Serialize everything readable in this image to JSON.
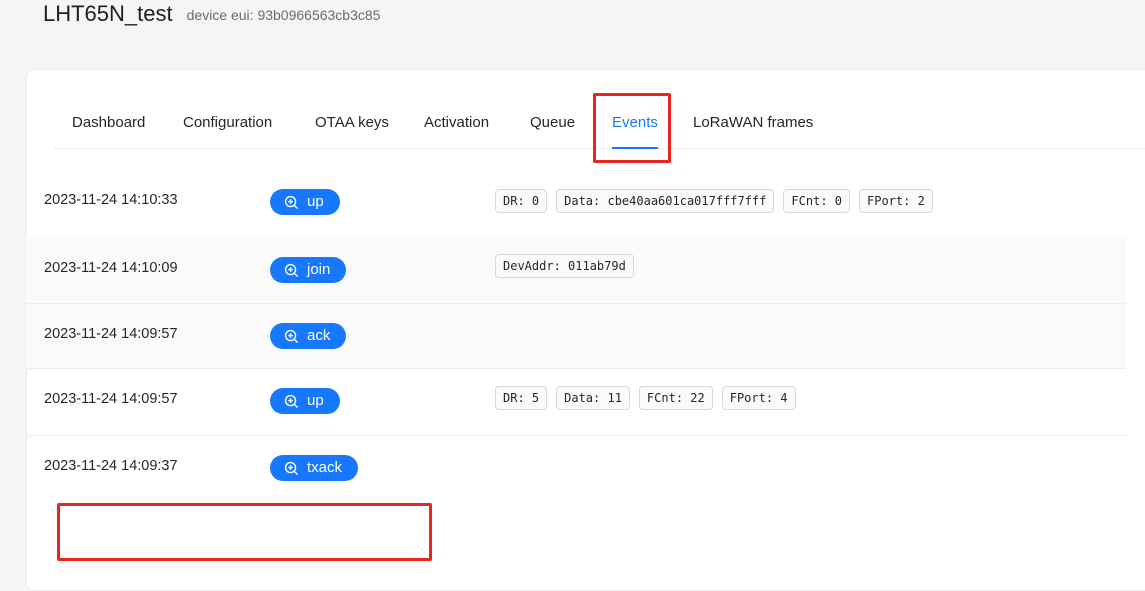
{
  "header": {
    "title": "LHT65N_test",
    "subtitle": "device eui: 93b0966563cb3c85"
  },
  "tabs": [
    {
      "label": "Dashboard"
    },
    {
      "label": "Configuration"
    },
    {
      "label": "OTAA keys"
    },
    {
      "label": "Activation"
    },
    {
      "label": "Queue"
    },
    {
      "label": "Events",
      "active": true
    },
    {
      "label": "LoRaWAN frames"
    }
  ],
  "events": [
    {
      "time": "2023-11-24 14:10:33",
      "type": "up",
      "tags": [
        "DR: 0",
        "Data: cbe40aa601ca017fff7fff",
        "FCnt: 0",
        "FPort: 2"
      ]
    },
    {
      "time": "2023-11-24 14:10:09",
      "type": "join",
      "tags": [
        "DevAddr: 011ab79d"
      ]
    },
    {
      "time": "2023-11-24 14:09:57",
      "type": "ack",
      "tags": []
    },
    {
      "time": "2023-11-24 14:09:57",
      "type": "up",
      "tags": [
        "DR: 5",
        "Data: 11",
        "FCnt: 22",
        "FPort: 4"
      ]
    },
    {
      "time": "2023-11-24 14:09:37",
      "type": "txack",
      "tags": []
    }
  ],
  "icons": {
    "event_button": "zoom-in-icon"
  },
  "colors": {
    "accent": "#1677ff",
    "highlight": "#e8251f"
  }
}
